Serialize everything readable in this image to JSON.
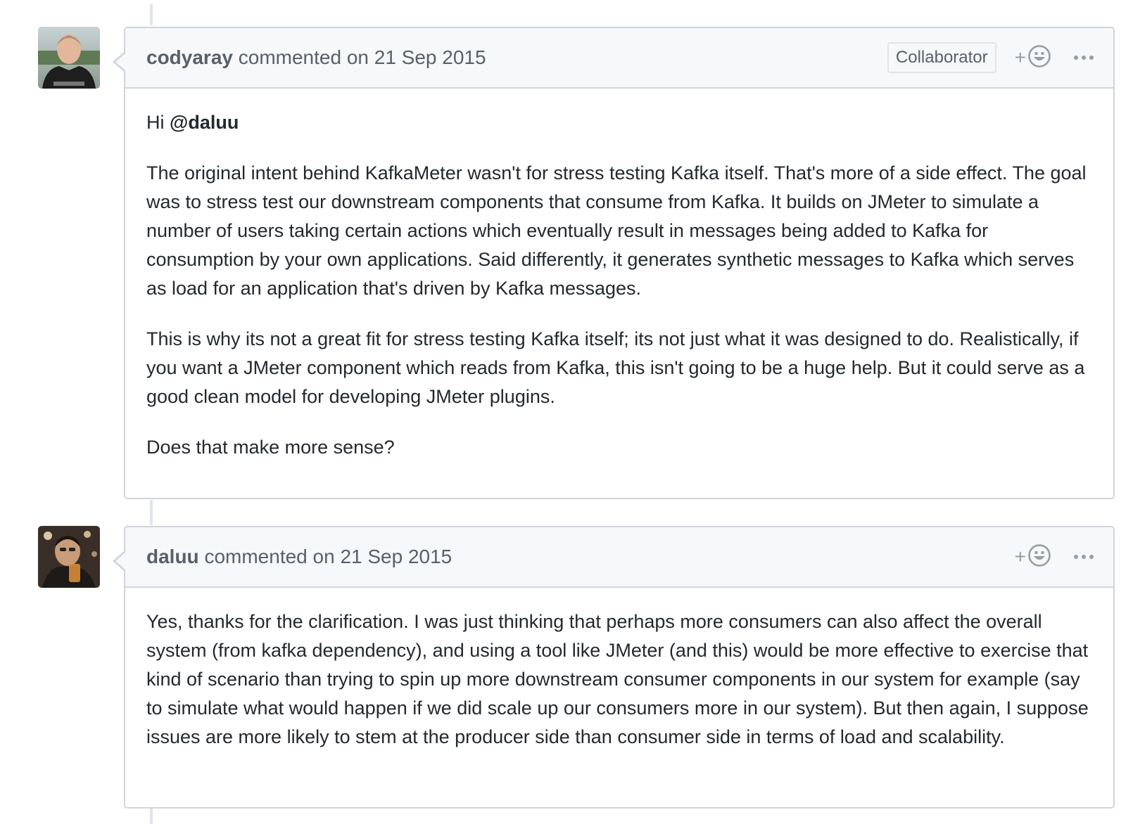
{
  "comments": [
    {
      "author": "codyaray",
      "meta": "commented on 21 Sep 2015",
      "badge": "Collaborator",
      "greeting": "Hi ",
      "mention": "@daluu",
      "paragraphs": [
        "The original intent behind KafkaMeter wasn't for stress testing Kafka itself. That's more of a side effect. The goal was to stress test our downstream components that consume from Kafka. It builds on JMeter to simulate a number of users taking certain actions which eventually result in messages being added to Kafka for consumption by your own applications. Said differently, it generates synthetic messages to Kafka which serves as load for an application that's driven by Kafka messages.",
        "This is why its not a great fit for stress testing Kafka itself; its not just what it was designed to do. Realistically, if you want a JMeter component which reads from Kafka, this isn't going to be a huge help. But it could serve as a good clean model for developing JMeter plugins.",
        "Does that make more sense?"
      ]
    },
    {
      "author": "daluu",
      "meta": "commented on 21 Sep 2015",
      "paragraphs": [
        "Yes, thanks for the clarification. I was just thinking that perhaps more consumers can also affect the overall system (from kafka dependency), and using a tool like JMeter (and this) would be more effective to exercise that kind of scenario than trying to spin up more downstream consumer components in our system for example (say to simulate what would happen if we did scale up our consumers more in our system). But then again, I suppose issues are more likely to stem at the producer side than consumer side in terms of load and scalability."
      ]
    }
  ],
  "icons": {
    "reaction": "add-reaction-smiley-icon",
    "more": "kebab-horizontal-icon"
  },
  "colors": {
    "border": "#d1d5da",
    "header_bg": "#f6f8fa",
    "muted_text": "#586069",
    "icon": "#959da5"
  }
}
